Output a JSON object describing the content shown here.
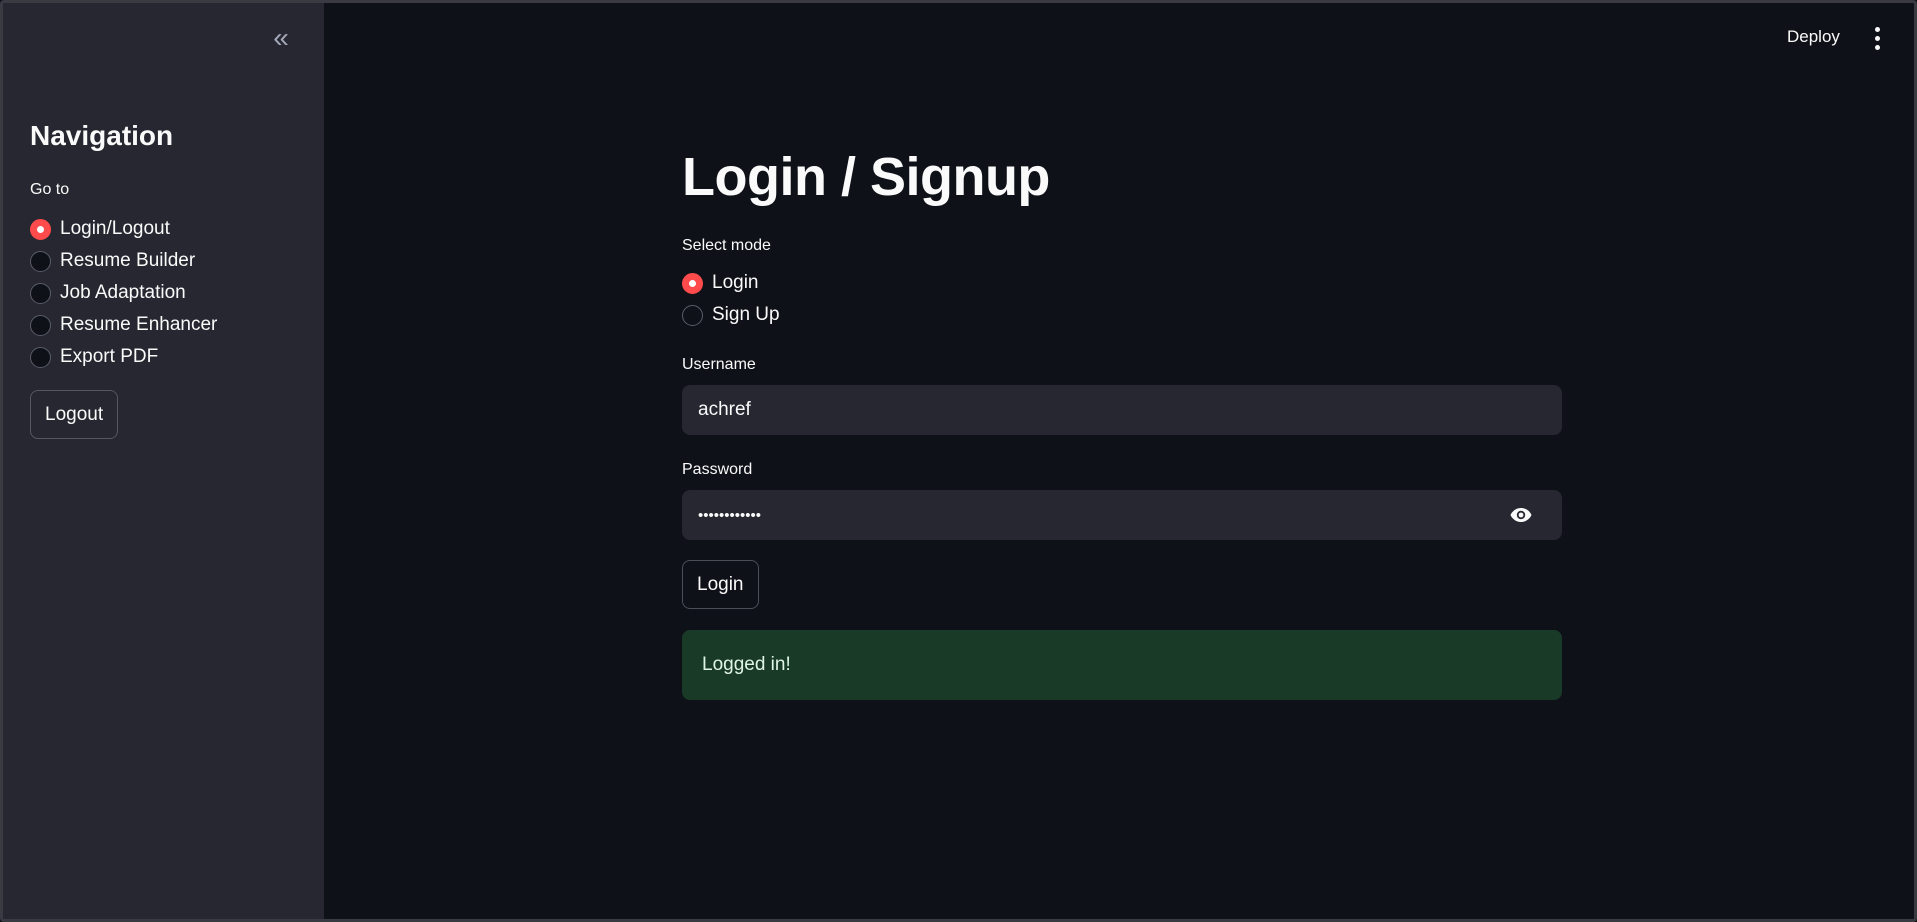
{
  "sidebar": {
    "collapse_glyph": "«",
    "title": "Navigation",
    "goto_label": "Go to",
    "items": [
      {
        "label": "Login/Logout",
        "selected": true
      },
      {
        "label": "Resume Builder",
        "selected": false
      },
      {
        "label": "Job Adaptation",
        "selected": false
      },
      {
        "label": "Resume Enhancer",
        "selected": false
      },
      {
        "label": "Export PDF",
        "selected": false
      }
    ],
    "logout_label": "Logout"
  },
  "topbar": {
    "deploy_label": "Deploy",
    "menu_icon": "vertical-ellipsis-icon"
  },
  "main": {
    "title": "Login / Signup",
    "mode_label": "Select mode",
    "modes": [
      {
        "label": "Login",
        "selected": true
      },
      {
        "label": "Sign Up",
        "selected": false
      }
    ],
    "username_label": "Username",
    "username_value": "achref",
    "password_label": "Password",
    "password_value": "••••••••••••",
    "password_toggle_icon": "eye-icon",
    "login_button_label": "Login",
    "success_message": "Logged in!"
  },
  "colors": {
    "background": "#0e1117",
    "sidebar": "#262730",
    "input": "#262730",
    "accent": "#ff4b4b",
    "success_bg": "#1a3a28"
  }
}
